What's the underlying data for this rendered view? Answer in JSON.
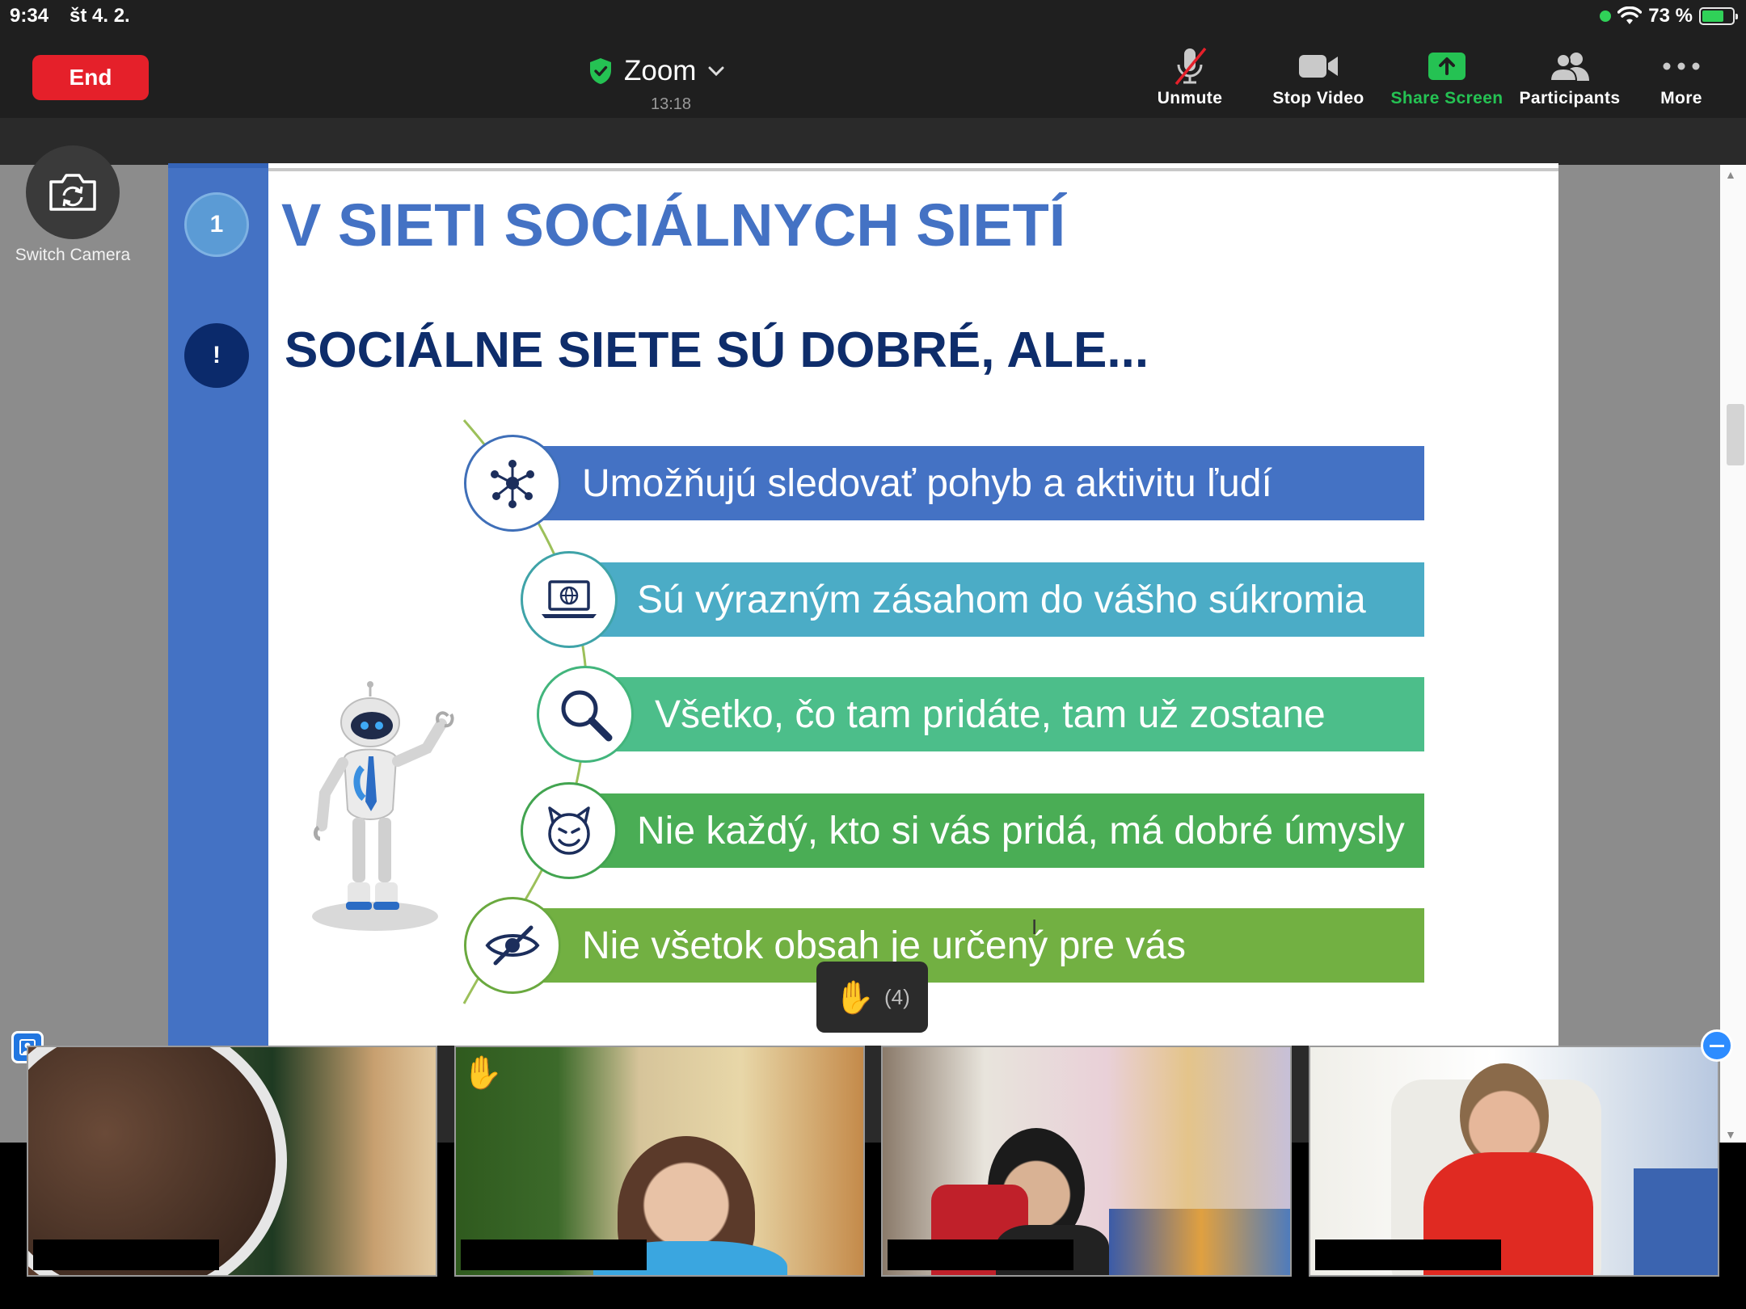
{
  "status_bar": {
    "time": "9:34",
    "date": "št 4. 2.",
    "battery": "73 %",
    "battery_level": 0.73
  },
  "toolbar": {
    "end_label": "End",
    "meeting_title": "Zoom",
    "timer": "13:18",
    "unmute_label": "Unmute",
    "stop_video_label": "Stop Video",
    "share_screen_label": "Share Screen",
    "participants_label": "Participants",
    "more_label": "More"
  },
  "switch_camera_label": "Switch Camera",
  "slide": {
    "badge_1": "1",
    "badge_2": "!",
    "title": "V SIETI SOCIÁLNYCH SIETÍ",
    "subtitle": "SOCIÁLNE SIETE SÚ DOBRÉ, ALE...",
    "items": [
      {
        "text": "Umožňujú sledovať pohyb a aktivitu ľudí",
        "icon": "network-icon"
      },
      {
        "text": "Sú výrazným zásahom do vášho súkromia",
        "icon": "laptop-globe-icon"
      },
      {
        "text": "Všetko, čo tam pridáte, tam už zostane",
        "icon": "magnifier-icon"
      },
      {
        "text": "Nie každý, kto si vás pridá, má dobré úmysly",
        "icon": "devil-face-icon"
      },
      {
        "text": "Nie všetok obsah je určený pre vás",
        "icon": "eye-slash-icon"
      }
    ]
  },
  "raised_hands": {
    "emoji": "✋",
    "count": "(4)"
  },
  "video_tiles": [
    {
      "hand_raised": false
    },
    {
      "hand_raised": true,
      "hand_emoji": "✋"
    },
    {
      "hand_raised": false
    },
    {
      "hand_raised": false
    }
  ],
  "colors": {
    "end_red": "#e5202a",
    "share_green": "#25c253",
    "slide_blue": "#4472c4",
    "slide_navy": "#0e2d6b"
  }
}
